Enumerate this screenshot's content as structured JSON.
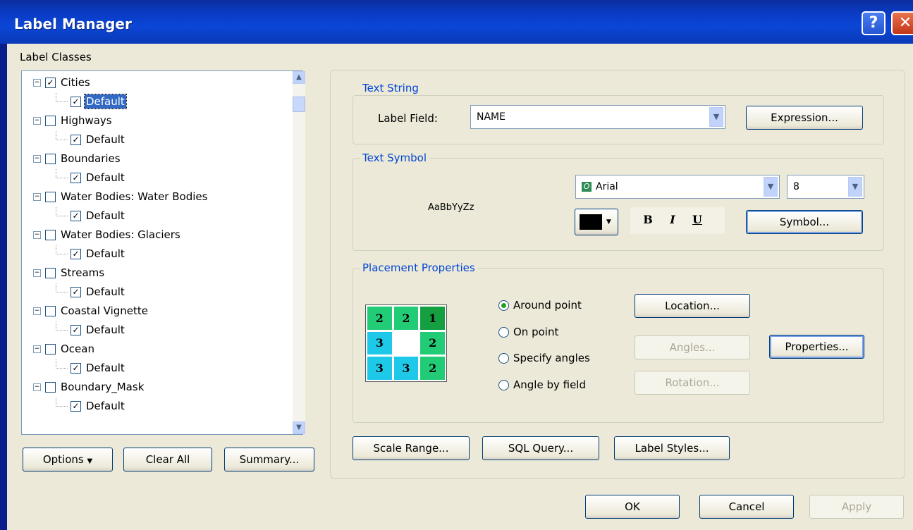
{
  "window": {
    "title": "Label Manager",
    "help_glyph": "?",
    "close_glyph": "✕"
  },
  "label_classes": {
    "heading": "Label Classes",
    "items": [
      {
        "label": "Cities",
        "checked": true,
        "child": {
          "label": "Default",
          "checked": true,
          "selected": true
        }
      },
      {
        "label": "Highways",
        "checked": false,
        "child": {
          "label": "Default",
          "checked": true
        }
      },
      {
        "label": "Boundaries",
        "checked": false,
        "child": {
          "label": "Default",
          "checked": true
        }
      },
      {
        "label": "Water Bodies: Water Bodies",
        "checked": false,
        "child": {
          "label": "Default",
          "checked": true
        }
      },
      {
        "label": "Water Bodies: Glaciers",
        "checked": false,
        "child": {
          "label": "Default",
          "checked": true
        }
      },
      {
        "label": "Streams",
        "checked": false,
        "child": {
          "label": "Default",
          "checked": true
        }
      },
      {
        "label": "Coastal Vignette",
        "checked": false,
        "child": {
          "label": "Default",
          "checked": true
        }
      },
      {
        "label": "Ocean",
        "checked": false,
        "child": {
          "label": "Default",
          "checked": true
        }
      },
      {
        "label": "Boundary_Mask",
        "checked": false,
        "child": {
          "label": "Default",
          "checked": true
        }
      }
    ],
    "buttons": {
      "options": "Options",
      "clear_all": "Clear All",
      "summary": "Summary..."
    }
  },
  "text_string": {
    "heading": "Text String",
    "label_field_label": "Label Field:",
    "label_field_value": "NAME",
    "expression_button": "Expression..."
  },
  "text_symbol": {
    "heading": "Text Symbol",
    "preview_text": "AaBbYyZz",
    "font_value": "Arial",
    "size_value": "8",
    "color": "#000000",
    "bold": "B",
    "italic": "I",
    "underline": "U",
    "symbol_button": "Symbol..."
  },
  "placement": {
    "heading": "Placement Properties",
    "grid": [
      {
        "value": "2",
        "color": "#22cc77"
      },
      {
        "value": "2",
        "color": "#22cc77"
      },
      {
        "value": "1",
        "color": "#14a041"
      },
      {
        "value": "3",
        "color": "#1ec8e8"
      },
      {
        "value": "",
        "color": "#ffffff"
      },
      {
        "value": "2",
        "color": "#22cc77"
      },
      {
        "value": "3",
        "color": "#1ec8e8"
      },
      {
        "value": "3",
        "color": "#1ec8e8"
      },
      {
        "value": "2",
        "color": "#22cc77"
      }
    ],
    "options": [
      {
        "label": "Around point",
        "selected": true
      },
      {
        "label": "On point",
        "selected": false
      },
      {
        "label": "Specify angles",
        "selected": false
      },
      {
        "label": "Angle by field",
        "selected": false
      }
    ],
    "location_button": "Location...",
    "angles_button": "Angles...",
    "rotation_button": "Rotation...",
    "properties_button": "Properties..."
  },
  "bottom_buttons": {
    "scale_range": "Scale Range...",
    "sql_query": "SQL Query...",
    "label_styles": "Label Styles..."
  },
  "dialog_buttons": {
    "ok": "OK",
    "cancel": "Cancel",
    "apply": "Apply"
  }
}
